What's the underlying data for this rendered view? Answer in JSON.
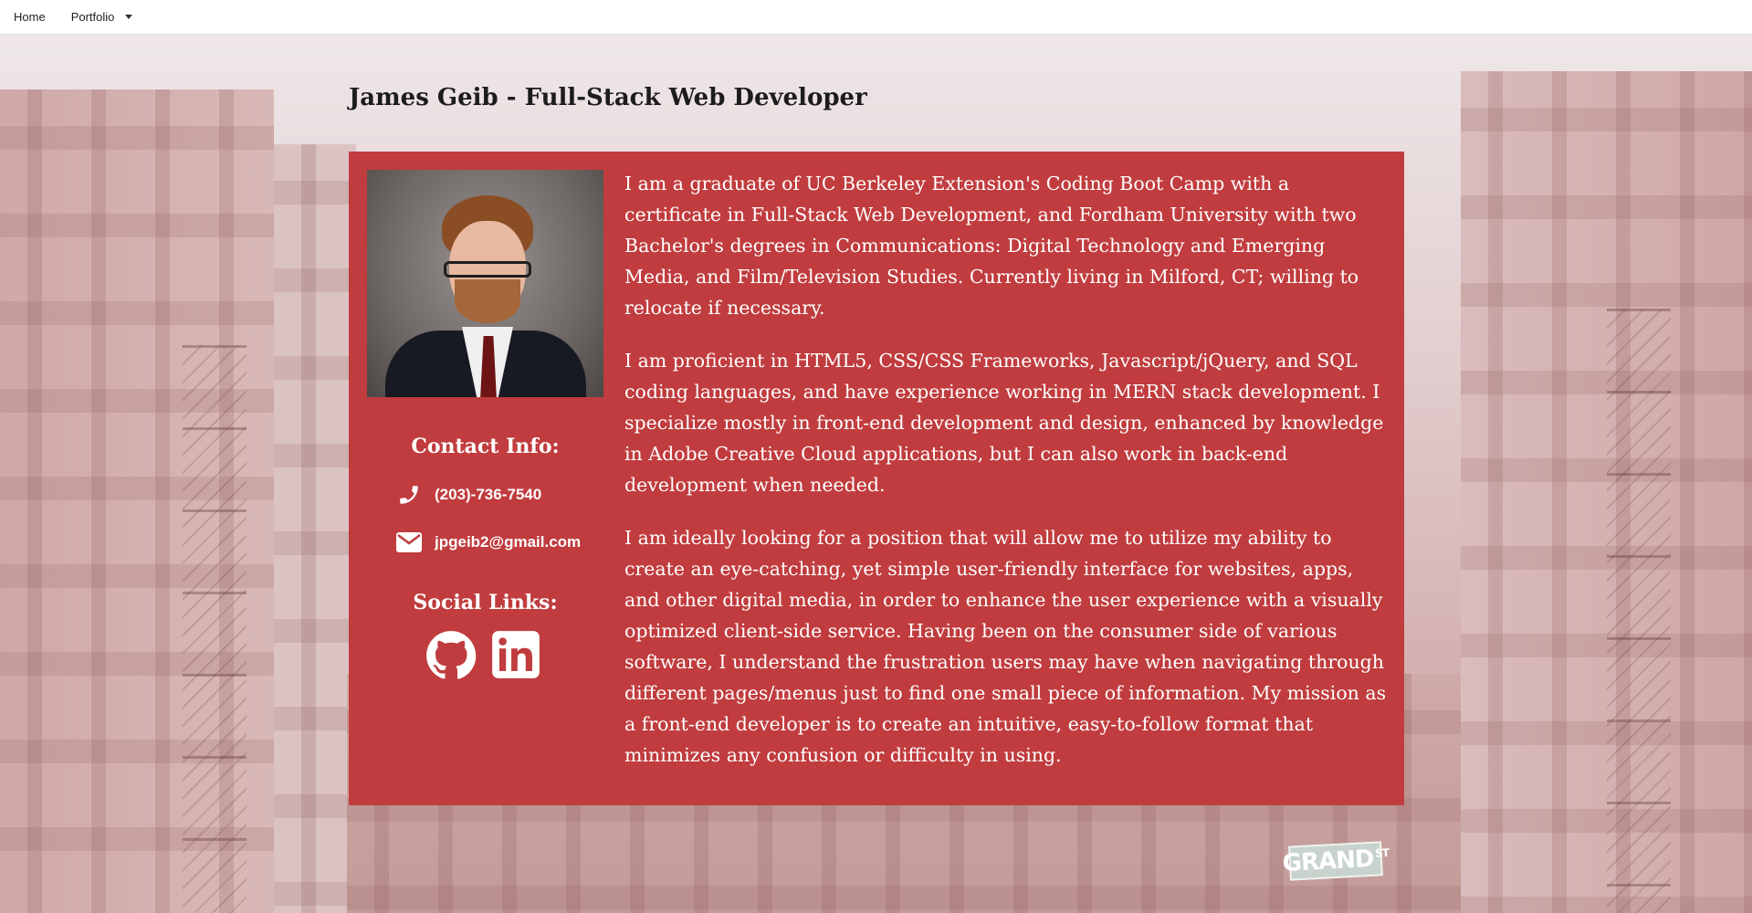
{
  "nav": {
    "home": "Home",
    "portfolio": "Portfolio"
  },
  "page": {
    "title": "James Geib - Full-Stack Web Developer"
  },
  "profile": {
    "contact_heading": "Contact Info:",
    "phone": "(203)-736-7540",
    "email": "jpgeib2@gmail.com",
    "social_heading": "Social Links:",
    "social_icons": [
      "github-icon",
      "linkedin-icon"
    ]
  },
  "bio": [
    "I am a graduate of UC Berkeley Extension's Coding Boot Camp with a certificate in Full-Stack Web Development, and Fordham University with two Bachelor's degrees in Communications: Digital Technology and Emerging Media, and Film/Television Studies. Currently living in Milford, CT; willing to relocate if necessary.",
    "I am proficient in HTML5, CSS/CSS Frameworks, Javascript/jQuery, and SQL coding languages, and have experience working in MERN stack development. I specialize mostly in front-end development and design, enhanced by knowledge in Adobe Creative Cloud applications, but I can also work in back-end development when needed.",
    "I am ideally looking for a position that will allow me to utilize my ability to create an eye-catching, yet simple user-friendly interface for websites, apps, and other digital media, in order to enhance the user experience with a visually optimized client-side service. Having been on the consumer side of various software, I understand the frustration users may have when navigating through different pages/menus just to find one small piece of information. My mission as a front-end developer is to create an intuitive, easy-to-follow format that minimizes any confusion or difficulty in using."
  ],
  "background": {
    "street_sign": "GRAND",
    "street_sign_suffix": "ST"
  },
  "colors": {
    "card": "#c03c3e",
    "text_light": "#ffffff",
    "title": "#1c1c1c"
  }
}
